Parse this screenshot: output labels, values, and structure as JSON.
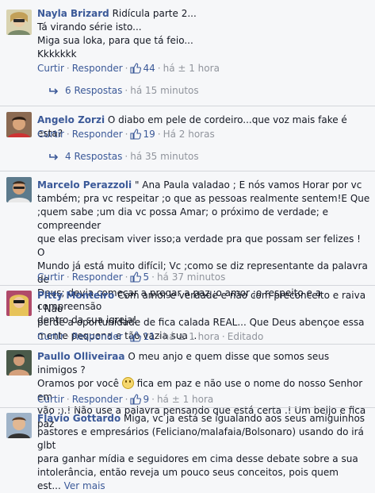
{
  "labels": {
    "like": "Curtir",
    "reply": "Responder",
    "edited": "Editado",
    "see_more": "Ver mais"
  },
  "comments": [
    {
      "author": "Nayla Brizard",
      "lines": [
        "Ridícula parte 2...",
        "Tá virando série isto...",
        "Miga sua loka, para que tá feio...",
        "Kkkkkkk"
      ],
      "likes": "44",
      "time": "há ± 1 hora",
      "replies": {
        "count_label": "6 Respostas",
        "time": "há 15 minutos"
      }
    },
    {
      "author": "Angelo Zorzi",
      "lines": [
        "O diabo em pele de cordeiro...que voz mais fake é esta?"
      ],
      "likes": "19",
      "time": "Há 2 horas",
      "replies": {
        "count_label": "4 Respostas",
        "time": "há 35 minutos"
      }
    },
    {
      "author": "Marcelo Perazzoli",
      "lines": [
        "\" Ana Paula valadao ; E nós vamos Horar por vc",
        "também; pra vc respeitar ;o que as pessoas realmente sentem!E Que",
        ";quem sabe ;um dia vc possa Amar; o próximo de verdade; e compreender",
        "que elas precisam viver isso;a verdade pra que possam ser felizes ! O",
        "Mundo já está muito difícil; Vc ;como se diz representante da palavra de",
        "Deus; devia começar a pregar a paz ;o amor ;o respeito e a compreensão",
        "dentro da sua igreja!"
      ],
      "likes": "5",
      "time": "há 37 minutos"
    },
    {
      "author": "Pitty Monteiro",
      "lines": [
        "Com amor e verdade e não com preconceito e raiva ! Não",
        "perde a oportunidade de fica calada REAL... Que Deus abençoe essa",
        "mente pequena e tão vazia sua .."
      ],
      "likes": "11",
      "time": "há ± 1 hora",
      "edited": true
    },
    {
      "author": "Paullo Olliveiraa",
      "line1": "O meu anjo e quem disse que somos seus inimigos ?",
      "line2_before": "Oramos por você",
      "line2_after": "fica em paz e não use o nome do nosso Senhor em",
      "line3_before": "vão",
      "line3_wink": ";)",
      "line3_after": ".! Não use a palavra pensando que está certa .! Um beijo e fica paz",
      "likes": "9",
      "time": "há ± 1 hora"
    },
    {
      "author": "Flávio Gottardo",
      "lines": [
        "Miga, vc ja está se igualando aos seus amiguinhos",
        "pastores e empresários (Feliciano/malafaia/Bolsonaro) usando do irá glbt",
        "para ganhar mídia e seguidores em cima desse debate sobre a sua",
        "intolerância, então reveja um pouco seus conceitos, pois quem"
      ],
      "last_line": "est..."
    }
  ]
}
